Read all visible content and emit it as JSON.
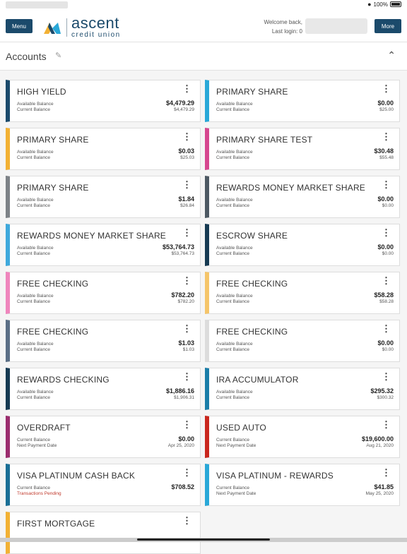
{
  "status": {
    "battery": "100%"
  },
  "header": {
    "menu_label": "Menu",
    "more_label": "More",
    "logo_name": "ascent",
    "logo_sub": "credit union",
    "welcome": "Welcome back,",
    "last_login": "Last login: 0"
  },
  "accounts_header": {
    "title": "Accounts"
  },
  "colors": {
    "navy": "#1b4a6b"
  },
  "accounts": [
    {
      "name": "HIGH YIELD",
      "color": "#1b4a6b",
      "l1": "Available Balance",
      "v1": "$4,479.29",
      "l2": "Current Balance",
      "v2": "$4,479.29"
    },
    {
      "name": "PRIMARY SHARE",
      "color": "#29a8d8",
      "l1": "Available Balance",
      "v1": "$0.00",
      "l2": "Current Balance",
      "v2": "$25.00"
    },
    {
      "name": "PRIMARY SHARE",
      "color": "#f2b134",
      "l1": "Available Balance",
      "v1": "$0.03",
      "l2": "Current Balance",
      "v2": "$25.03"
    },
    {
      "name": "PRIMARY SHARE TEST",
      "color": "#d6478f",
      "l1": "Available Balance",
      "v1": "$30.48",
      "l2": "Current Balance",
      "v2": "$55.48"
    },
    {
      "name": "PRIMARY SHARE",
      "color": "#7d8287",
      "l1": "Available Balance",
      "v1": "$1.84",
      "l2": "Current Balance",
      "v2": "$26.84"
    },
    {
      "name": "REWARDS MONEY MARKET SHARE",
      "color": "#4d5963",
      "l1": "Available Balance",
      "v1": "$0.00",
      "l2": "Current Balance",
      "v2": "$0.00"
    },
    {
      "name": "REWARDS MONEY MARKET SHARE",
      "color": "#3fa9dc",
      "l1": "Available Balance",
      "v1": "$53,764.73",
      "l2": "Current Balance",
      "v2": "$53,764.73"
    },
    {
      "name": "ESCROW SHARE",
      "color": "#163a52",
      "l1": "Available Balance",
      "v1": "$0.00",
      "l2": "Current Balance",
      "v2": "$0.00"
    },
    {
      "name": "FREE CHECKING",
      "color": "#ef86bd",
      "l1": "Available Balance",
      "v1": "$782.20",
      "l2": "Current Balance",
      "v2": "$782.20"
    },
    {
      "name": "FREE CHECKING",
      "color": "#f5c56a",
      "l1": "Available Balance",
      "v1": "$58.28",
      "l2": "Current Balance",
      "v2": "$58.28"
    },
    {
      "name": "FREE CHECKING",
      "color": "#5b6f86",
      "l1": "Available Balance",
      "v1": "$1.03",
      "l2": "Current Balance",
      "v2": "$1.03"
    },
    {
      "name": "FREE CHECKING",
      "color": "#dcdcdc",
      "l1": "Available Balance",
      "v1": "$0.00",
      "l2": "Current Balance",
      "v2": "$0.00"
    },
    {
      "name": "REWARDS CHECKING",
      "color": "#163a52",
      "l1": "Available Balance",
      "v1": "$1,886.16",
      "l2": "Current Balance",
      "v2": "$1,906.31"
    },
    {
      "name": "IRA ACCUMULATOR",
      "color": "#1a7da8",
      "l1": "Available Balance",
      "v1": "$295.32",
      "l2": "Current Balance",
      "v2": "$300.32"
    },
    {
      "name": "OVERDRAFT",
      "color": "#9b2d6e",
      "l1": "Current Balance",
      "v1": "$0.00",
      "l2": "Next Payment Date",
      "v2": "Apr 25, 2020"
    },
    {
      "name": "USED AUTO",
      "color": "#c9271e",
      "l1": "Current Balance",
      "v1": "$19,600.00",
      "l2": "Next Payment Date",
      "v2": "Aug 21, 2020"
    },
    {
      "name": "VISA PLATINUM CASH BACK",
      "color": "#1a6f96",
      "l1": "Current Balance",
      "v1": "$708.52",
      "l2": "Transactions Pending",
      "v2": "",
      "l2_alert": true
    },
    {
      "name": "VISA PLATINUM - REWARDS",
      "color": "#29a8d8",
      "l1": "Current Balance",
      "v1": "$41.85",
      "l2": "Next Payment Date",
      "v2": "May 25, 2020"
    },
    {
      "name": "FIRST MORTGAGE",
      "color": "#f2b134",
      "l1": "",
      "v1": "",
      "l2": "",
      "v2": ""
    }
  ]
}
